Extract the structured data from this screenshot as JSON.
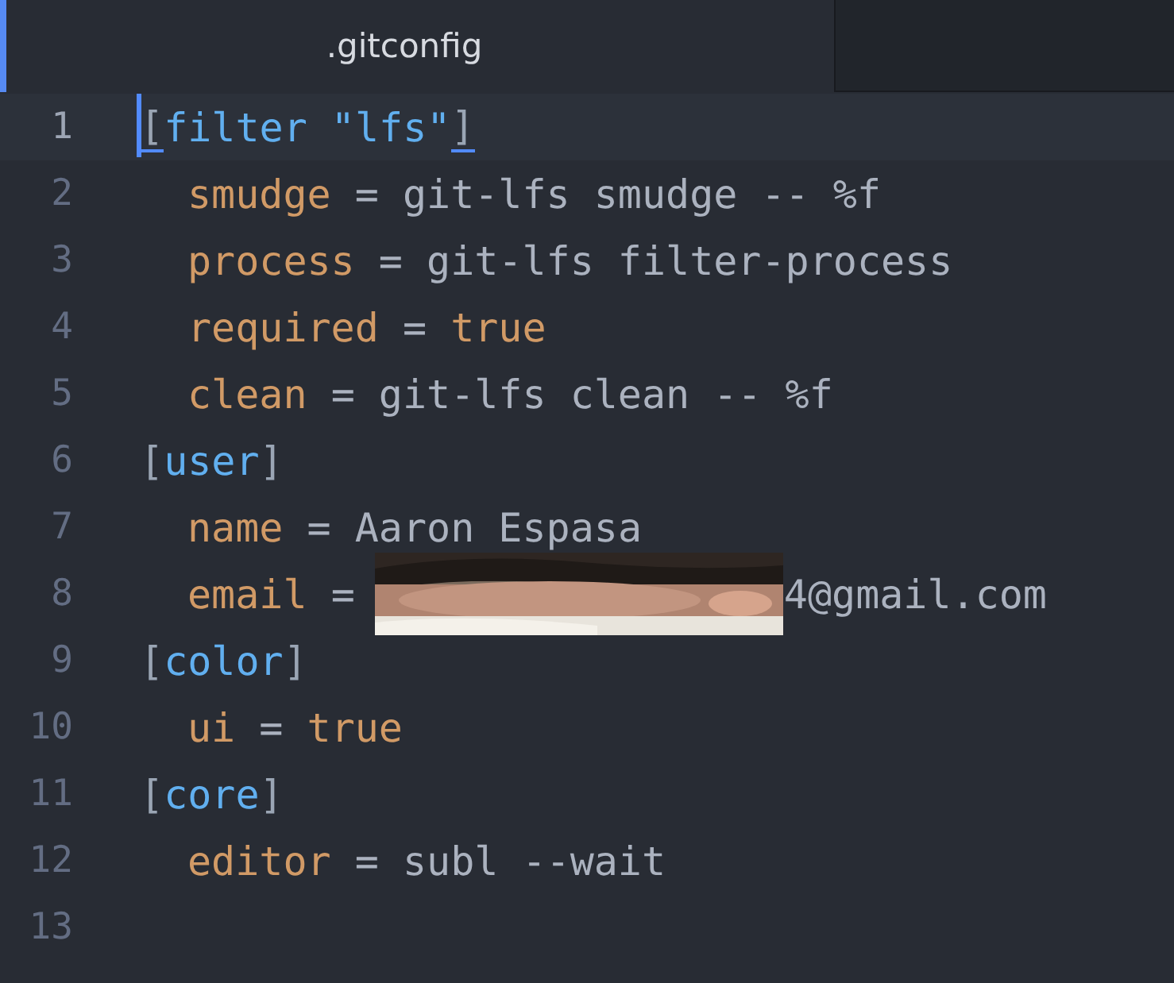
{
  "tabs": [
    {
      "title": ".gitconfig",
      "selected": true
    }
  ],
  "lines": [
    {
      "number": "1",
      "current": true,
      "tokens": [
        {
          "kind": "bracket_match",
          "text": "["
        },
        {
          "kind": "section",
          "text": "filter "
        },
        {
          "kind": "string",
          "text": "\"lfs\""
        },
        {
          "kind": "bracket_match",
          "text": "]"
        }
      ]
    },
    {
      "number": "2",
      "current": false,
      "tokens": [
        {
          "kind": "key",
          "text": "smudge"
        },
        {
          "kind": "op",
          "text": " = "
        },
        {
          "kind": "value",
          "text": "git-lfs smudge -- %f"
        }
      ]
    },
    {
      "number": "3",
      "current": false,
      "tokens": [
        {
          "kind": "key",
          "text": "process"
        },
        {
          "kind": "op",
          "text": " = "
        },
        {
          "kind": "value",
          "text": "git-lfs filter-process"
        }
      ]
    },
    {
      "number": "4",
      "current": false,
      "tokens": [
        {
          "kind": "key",
          "text": "required"
        },
        {
          "kind": "op",
          "text": " = "
        },
        {
          "kind": "bool",
          "text": "true"
        }
      ]
    },
    {
      "number": "5",
      "current": false,
      "tokens": [
        {
          "kind": "key",
          "text": "clean"
        },
        {
          "kind": "op",
          "text": " = "
        },
        {
          "kind": "value",
          "text": "git-lfs clean -- %f"
        }
      ]
    },
    {
      "number": "6",
      "current": false,
      "tokens": [
        {
          "kind": "bracket",
          "text": "["
        },
        {
          "kind": "section",
          "text": "user"
        },
        {
          "kind": "bracket",
          "text": "]"
        }
      ]
    },
    {
      "number": "7",
      "current": false,
      "tokens": [
        {
          "kind": "key",
          "text": "name"
        },
        {
          "kind": "op",
          "text": " = "
        },
        {
          "kind": "value",
          "text": "Aaron Espasa"
        }
      ]
    },
    {
      "number": "8",
      "current": false,
      "tokens": [
        {
          "kind": "key",
          "text": "email"
        },
        {
          "kind": "op",
          "text": " = "
        },
        {
          "kind": "picture"
        },
        {
          "kind": "value",
          "text": "4@gmail.com"
        }
      ]
    },
    {
      "number": "9",
      "current": false,
      "tokens": [
        {
          "kind": "bracket",
          "text": "["
        },
        {
          "kind": "section",
          "text": "color"
        },
        {
          "kind": "bracket",
          "text": "]"
        }
      ]
    },
    {
      "number": "10",
      "current": false,
      "tokens": [
        {
          "kind": "key",
          "text": "ui"
        },
        {
          "kind": "op",
          "text": " = "
        },
        {
          "kind": "bool",
          "text": "true"
        }
      ]
    },
    {
      "number": "11",
      "current": false,
      "tokens": [
        {
          "kind": "bracket",
          "text": "["
        },
        {
          "kind": "section",
          "text": "core"
        },
        {
          "kind": "bracket",
          "text": "]"
        }
      ]
    },
    {
      "number": "12",
      "current": false,
      "tokens": [
        {
          "kind": "key",
          "text": "editor"
        },
        {
          "kind": "op",
          "text": " = "
        },
        {
          "kind": "value",
          "text": "subl --wait"
        }
      ]
    },
    {
      "number": "13",
      "current": false
    }
  ]
}
